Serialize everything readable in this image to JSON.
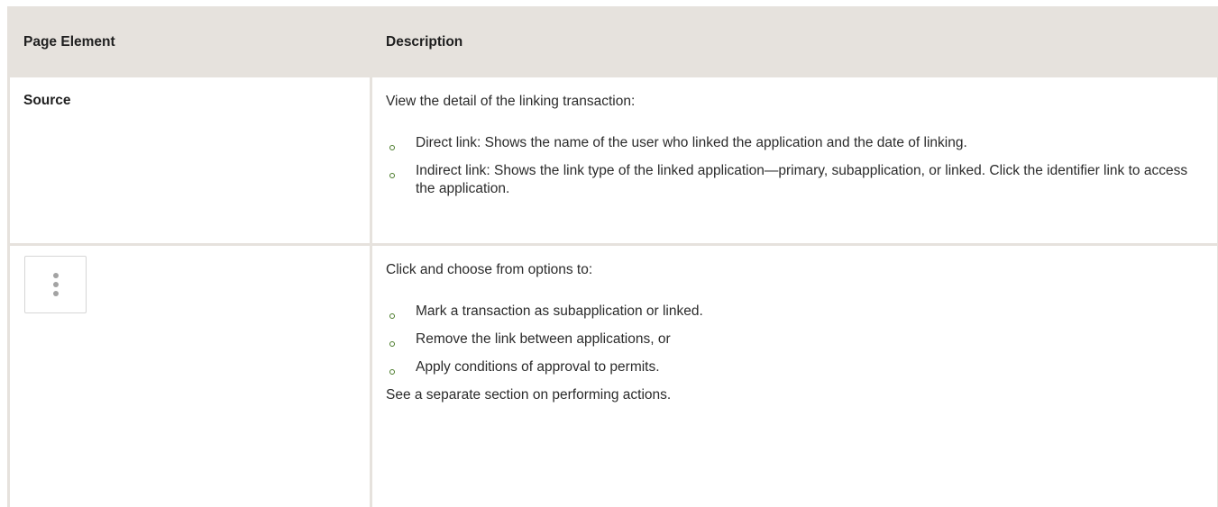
{
  "table": {
    "headers": {
      "element": "Page Element",
      "description": "Description"
    },
    "rows": [
      {
        "element_label": "Source",
        "intro": "View the detail of the linking transaction:",
        "bullets": [
          "Direct link: Shows the name of the user who linked the application and the date of linking.",
          "Indirect link: Shows the link type of the linked application—primary, subapplication, or linked. Click the identifier link to access the application."
        ]
      },
      {
        "element_icon": "more-vertical-icon",
        "intro": "Click and choose from options to:",
        "bullets": [
          "Mark a transaction as subapplication or linked.",
          "Remove the link between applications, or",
          "Apply conditions of approval to permits."
        ],
        "footer": "See a separate section on performing actions."
      }
    ]
  },
  "colors": {
    "border": "#e6e2dd",
    "header_bg": "#e6e2dd",
    "bullet": "#4a7a2a",
    "icon_dots": "#a3a3a3"
  }
}
